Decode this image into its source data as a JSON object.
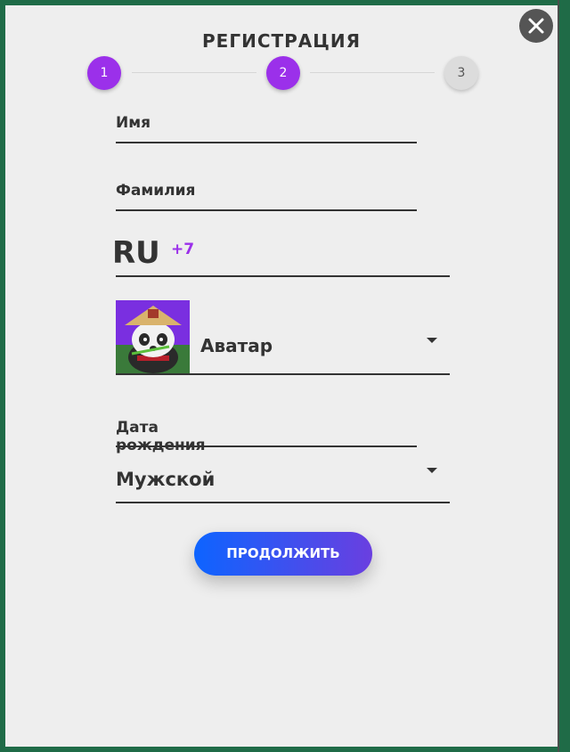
{
  "header": {
    "title": "РЕГИСТРАЦИЯ",
    "close_icon": "close-icon"
  },
  "stepper": {
    "steps": [
      "1",
      "2",
      "3"
    ],
    "current_step": 2,
    "completed_color": "#9b30ea"
  },
  "form": {
    "first_name_label": "Имя",
    "last_name_label": "Фамилия",
    "phone": {
      "country": "RU",
      "code": "+7"
    },
    "avatar": {
      "label": "Аватар",
      "image": "panda-avatar"
    },
    "birth_date_label": "Дата рождения",
    "gender": {
      "selected": "Мужской"
    },
    "submit_label": "ПРОДОЛЖИТЬ"
  },
  "colors": {
    "accent": "#9b30ea",
    "button_start": "#0d64ff",
    "button_end": "#6a3fe0"
  }
}
